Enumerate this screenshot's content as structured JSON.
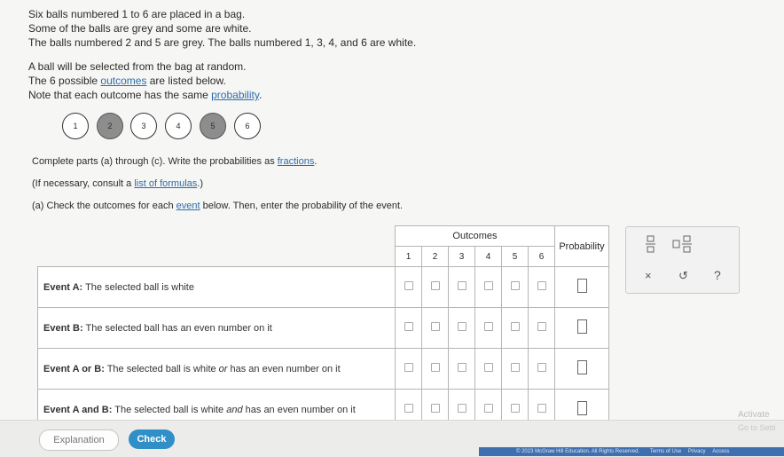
{
  "intro": {
    "l1": "Six balls numbered 1 to 6 are placed in a bag.",
    "l2": "Some of the balls are grey and some are white.",
    "l3": "The balls numbered 2 and 5 are grey. The balls numbered 1, 3, 4, and 6 are white."
  },
  "random": {
    "l1": "A ball will be selected from the bag at random.",
    "l2_pre": "The 6 possible ",
    "l2_link": "outcomes",
    "l2_post": " are listed below.",
    "l3_pre": "Note that each outcome has the same ",
    "l3_link": "probability",
    "l3_post": "."
  },
  "balls": [
    {
      "label": "1",
      "color": "white"
    },
    {
      "label": "2",
      "color": "grey"
    },
    {
      "label": "3",
      "color": "white"
    },
    {
      "label": "4",
      "color": "white"
    },
    {
      "label": "5",
      "color": "grey"
    },
    {
      "label": "6",
      "color": "white"
    }
  ],
  "instructions": {
    "parts_pre": "Complete parts (a) through (c). Write the probabilities as ",
    "parts_link": "fractions",
    "parts_post": ".",
    "consult_pre": "(If necessary, consult a ",
    "consult_link": "list of formulas",
    "consult_post": ".)",
    "a_pre": "(a) Check the outcomes for each ",
    "a_link": "event",
    "a_post": " below. Then, enter the probability of the event."
  },
  "table": {
    "outcomes_header": "Outcomes",
    "probability_header": "Probability",
    "outcome_numbers": [
      "1",
      "2",
      "3",
      "4",
      "5",
      "6"
    ],
    "events": [
      {
        "label": "Event A:",
        "desc_pre": " The selected ball is white",
        "desc_em": "",
        "desc_post": ""
      },
      {
        "label": "Event B:",
        "desc_pre": " The selected ball has an even number on it",
        "desc_em": "",
        "desc_post": ""
      },
      {
        "label": "Event A or B:",
        "desc_pre": " The selected ball is white ",
        "desc_em": "or",
        "desc_post": " has an even number on it"
      },
      {
        "label": "Event A and B:",
        "desc_pre": " The selected ball is white ",
        "desc_em": "and",
        "desc_post": " has an even number on it"
      }
    ]
  },
  "toolpanel": {
    "fraction_icon": "fraction-icon",
    "mixed_icon": "mixed-number-icon",
    "clear": "×",
    "undo": "↺",
    "help": "?"
  },
  "buttons": {
    "explanation": "Explanation",
    "check": "Check"
  },
  "watermark": {
    "activate": "Activate",
    "goto": "Go to Setti"
  },
  "footer": {
    "copyright": "© 2023 McGraw Hill Education. All Rights Reserved.",
    "terms": "Terms of Use",
    "privacy": "Privacy",
    "access": "Access"
  },
  "colors": {
    "link": "#2c6cab",
    "grey_ball": "#8d8d8d",
    "check_button": "#2f8fc6"
  }
}
